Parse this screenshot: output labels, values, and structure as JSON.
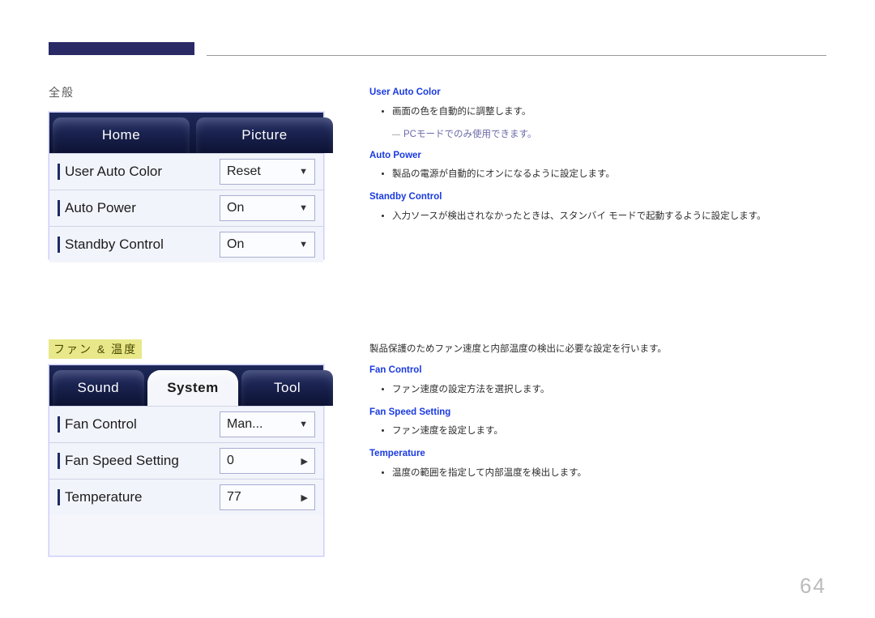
{
  "page_number": "64",
  "section1": {
    "title": "全般",
    "tabs": {
      "home": "Home",
      "picture": "Picture"
    },
    "rows": [
      {
        "label": "User Auto Color",
        "value": "Reset",
        "chev": "▼"
      },
      {
        "label": "Auto Power",
        "value": "On",
        "chev": "▼"
      },
      {
        "label": "Standby Control",
        "value": "On",
        "chev": "▼"
      }
    ],
    "desc": {
      "h1": "User Auto Color",
      "b1": "画面の色を自動的に調整します。",
      "b1sub": "PCモードでのみ使用できます。",
      "h2": "Auto Power",
      "b2": "製品の電源が自動的にオンになるように設定します。",
      "h3": "Standby Control",
      "b3": "入力ソースが検出されなかったときは、スタンバイ モードで起動するように設定します。"
    }
  },
  "section2": {
    "title": "ファン & 温度",
    "intro": "製品保護のためファン速度と内部温度の検出に必要な設定を行います。",
    "tabs": {
      "sound": "Sound",
      "system": "System",
      "tool": "Tool"
    },
    "rows": [
      {
        "label": "Fan Control",
        "value": "Man...",
        "chev": "▼"
      },
      {
        "label": "Fan Speed Setting",
        "value": "0",
        "chev": "▶"
      },
      {
        "label": "Temperature",
        "value": "77",
        "chev": "▶"
      }
    ],
    "desc": {
      "h1": "Fan Control",
      "b1": "ファン速度の設定方法を選択します。",
      "h2": "Fan Speed Setting",
      "b2": "ファン速度を設定します。",
      "h3": "Temperature",
      "b3": "温度の範囲を指定して内部温度を検出します。"
    }
  }
}
